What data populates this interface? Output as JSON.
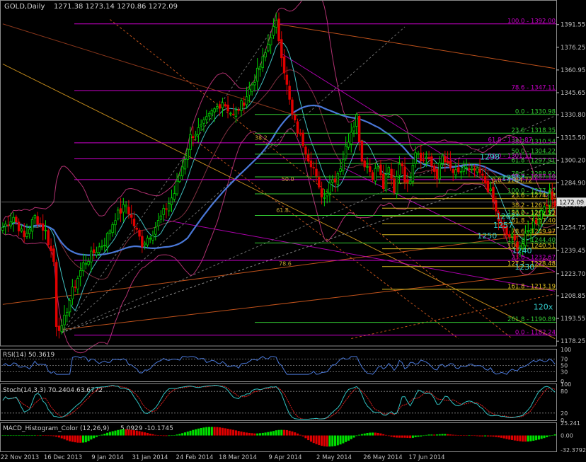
{
  "header": {
    "symbol": "GOLD,Daily",
    "ohlc": "1271.38 1273.14 1270.86 1272.09"
  },
  "colors": {
    "background": "#000000",
    "bull": "#00d000",
    "bear": "#e00000",
    "fib_magenta": "#cc00cc",
    "fib_green": "#33cc33",
    "fib_yellow": "#e0c020",
    "trend_orange": "#e06020",
    "ma_blue": "#4a78d8",
    "bands": "#b03070",
    "annotation_cyan": "#33cccc",
    "axis": "#c0c0c0",
    "price_box": "#e0e0e0"
  },
  "chart_data": [
    {
      "type": "candlestick",
      "name": "price",
      "title": "GOLD,Daily",
      "ylim": [
        1175,
        1400
      ],
      "yticks": [
        1391.55,
        1376.25,
        1360.95,
        1345.65,
        1330.8,
        1315.5,
        1300.2,
        1284.9,
        1270.05,
        1254.75,
        1239.45,
        1223.7,
        1208.85,
        1193.55,
        1178.25
      ],
      "y_tick_labels": [
        "1391.55",
        "1376.25",
        "1360.95",
        "1345.65",
        "1330.80",
        "1315.50",
        "1300.20",
        "1284.90",
        "1270.05",
        "1254.75",
        "1239.45",
        "1223.70",
        "1208.85",
        "1193.55",
        "1178.25"
      ],
      "x_tick_labels": [
        "22 Nov 2013",
        "16 Dec 2013",
        "9 Jan 2014",
        "31 Jan 2014",
        "24 Feb 2014",
        "18 Mar 2014",
        "9 Apr 2014",
        "2 May 2014",
        "26 May 2014",
        "17 Jun 2014"
      ],
      "current_price": "1272.09",
      "anchors": [
        [
          0,
          1255
        ],
        [
          4,
          1262
        ],
        [
          8,
          1248
        ],
        [
          12,
          1262
        ],
        [
          16,
          1252
        ],
        [
          19,
          1232
        ],
        [
          20,
          1190
        ],
        [
          22,
          1186
        ],
        [
          24,
          1200
        ],
        [
          26,
          1212
        ],
        [
          30,
          1230
        ],
        [
          34,
          1238
        ],
        [
          38,
          1245
        ],
        [
          42,
          1262
        ],
        [
          46,
          1270
        ],
        [
          50,
          1252
        ],
        [
          52,
          1244
        ],
        [
          56,
          1252
        ],
        [
          60,
          1265
        ],
        [
          64,
          1278
        ],
        [
          68,
          1302
        ],
        [
          70,
          1316
        ],
        [
          74,
          1322
        ],
        [
          78,
          1332
        ],
        [
          82,
          1340
        ],
        [
          86,
          1330
        ],
        [
          90,
          1340
        ],
        [
          94,
          1355
        ],
        [
          98,
          1372
        ],
        [
          100,
          1385
        ],
        [
          102,
          1392
        ],
        [
          104,
          1372
        ],
        [
          106,
          1350
        ],
        [
          108,
          1330
        ],
        [
          110,
          1320
        ],
        [
          112,
          1312
        ],
        [
          114,
          1302
        ],
        [
          116,
          1295
        ],
        [
          118,
          1280
        ],
        [
          120,
          1275
        ],
        [
          122,
          1286
        ],
        [
          124,
          1288
        ],
        [
          126,
          1296
        ],
        [
          128,
          1308
        ],
        [
          130,
          1321
        ],
        [
          132,
          1330
        ],
        [
          134,
          1300
        ],
        [
          136,
          1296
        ],
        [
          138,
          1290
        ],
        [
          140,
          1296
        ],
        [
          142,
          1282
        ],
        [
          144,
          1294
        ],
        [
          146,
          1280
        ],
        [
          148,
          1300
        ],
        [
          150,
          1288
        ],
        [
          152,
          1288
        ],
        [
          154,
          1308
        ],
        [
          156,
          1300
        ],
        [
          158,
          1302
        ],
        [
          160,
          1296
        ],
        [
          162,
          1290
        ],
        [
          164,
          1302
        ],
        [
          166,
          1296
        ],
        [
          168,
          1292
        ],
        [
          170,
          1290
        ],
        [
          172,
          1296
        ],
        [
          174,
          1292
        ],
        [
          176,
          1293
        ],
        [
          178,
          1291
        ],
        [
          180,
          1285
        ],
        [
          182,
          1278
        ],
        [
          184,
          1265
        ],
        [
          186,
          1255
        ],
        [
          188,
          1250
        ],
        [
          190,
          1248
        ],
        [
          192,
          1242
        ],
        [
          194,
          1244
        ],
        [
          196,
          1252
        ],
        [
          198,
          1258
        ],
        [
          200,
          1262
        ],
        [
          202,
          1270
        ],
        [
          204,
          1275
        ],
        [
          206,
          1272
        ]
      ],
      "fib_levels": [
        {
          "label": "100.0 - 1392.00",
          "price": 1392.0,
          "group": "magenta"
        },
        {
          "label": "78.6 - 1347.11",
          "price": 1347.11,
          "group": "magenta"
        },
        {
          "label": "0.0 - 1330.98",
          "price": 1330.98,
          "group": "green"
        },
        {
          "label": "23.6 - 1318.35",
          "price": 1318.35,
          "group": "green"
        },
        {
          "label": "38.2 - 1310.54",
          "price": 1310.54,
          "group": "green"
        },
        {
          "label": "61.8 - 1311.87",
          "price": 1311.87,
          "group": "magenta"
        },
        {
          "label": "50.0 - 1304.22",
          "price": 1304.22,
          "group": "green"
        },
        {
          "label": "50.0 - 1301.11",
          "price": 1301.11,
          "group": "magenta"
        },
        {
          "label": "61.8 - 1297.91",
          "price": 1297.91,
          "group": "green"
        },
        {
          "label": "78.6 - 1288.92",
          "price": 1288.92,
          "group": "green"
        },
        {
          "label": "38.2 - 1287.10",
          "price": 1287.1,
          "group": "magenta"
        },
        {
          "label": "0.0 - 1284.72",
          "price": 1284.72,
          "group": "yellow"
        },
        {
          "label": "100.0 - 1277.47",
          "price": 1277.47,
          "group": "green"
        },
        {
          "label": "23.6 - 1274.29",
          "price": 1274.29,
          "group": "yellow"
        },
        {
          "label": "38.2 - 1267.83",
          "price": 1267.83,
          "group": "yellow"
        },
        {
          "label": "127.2 - 1262.93",
          "price": 1262.93,
          "group": "green"
        },
        {
          "label": "50.0 - 1262.52",
          "price": 1262.52,
          "group": "yellow"
        },
        {
          "label": "61.8 - 1257.40",
          "price": 1257.4,
          "group": "yellow"
        },
        {
          "label": "78.6 - 1249.97",
          "price": 1249.97,
          "group": "yellow"
        },
        {
          "label": "161.8 - 1244.40",
          "price": 1244.4,
          "group": "green"
        },
        {
          "label": "100.0 - 1240.51",
          "price": 1240.51,
          "group": "yellow"
        },
        {
          "label": "23.6 - 1232.67",
          "price": 1232.67,
          "group": "magenta"
        },
        {
          "label": "127.2 - 1228.48",
          "price": 1228.48,
          "group": "yellow"
        },
        {
          "label": "161.8 - 1213.19",
          "price": 1213.19,
          "group": "yellow"
        },
        {
          "label": "261.8 - 1190.89",
          "price": 1190.89,
          "group": "green"
        },
        {
          "label": "0.0 - 1182.24",
          "price": 1182.24,
          "group": "magenta"
        }
      ],
      "annotations": [
        {
          "text": "1298",
          "price": 1300.5,
          "bar": 178
        },
        {
          "text": "1285*",
          "price": 1286.5,
          "bar": 186
        },
        {
          "text": "1262*",
          "price": 1260.5,
          "bar": 184
        },
        {
          "text": "1257",
          "price": 1254.5,
          "bar": 183
        },
        {
          "text": "1250",
          "price": 1247.5,
          "bar": 177
        },
        {
          "text": "1240",
          "price": 1237.5,
          "bar": 190
        },
        {
          "text": "1230",
          "price": 1226.5,
          "bar": 191
        },
        {
          "text": "120x",
          "price": 1199.5,
          "bar": 198
        }
      ],
      "inner_fib_labels": [
        {
          "text": "38.2",
          "price": 1314,
          "bar": 94
        },
        {
          "text": "50.0",
          "price": 1286,
          "bar": 104
        },
        {
          "text": "61.8",
          "price": 1265,
          "bar": 102
        },
        {
          "text": "78.6",
          "price": 1229,
          "bar": 103
        }
      ]
    },
    {
      "type": "line",
      "name": "rsi",
      "title": "RSI(14) 50.3619",
      "ylim": [
        0,
        100
      ],
      "y_tick_labels": [
        "100",
        "70",
        "50",
        "30",
        "0"
      ],
      "levels": [
        70,
        50,
        30
      ]
    },
    {
      "type": "line",
      "name": "stoch",
      "title": "Stoch(14,3,3) 70.2404 63.6772",
      "ylim": [
        0,
        100
      ],
      "y_tick_labels": [
        "100",
        "80",
        "20",
        "0"
      ],
      "levels": [
        80,
        20
      ]
    },
    {
      "type": "bar",
      "name": "macd",
      "title": "MACD_Histogram_Color (12,26,9)",
      "values_text": "5.0929 -10.1745",
      "ylim": [
        -32.3792,
        25.241
      ],
      "y_tick_labels": [
        "25.241",
        "0.00",
        "-32.3792"
      ]
    }
  ]
}
